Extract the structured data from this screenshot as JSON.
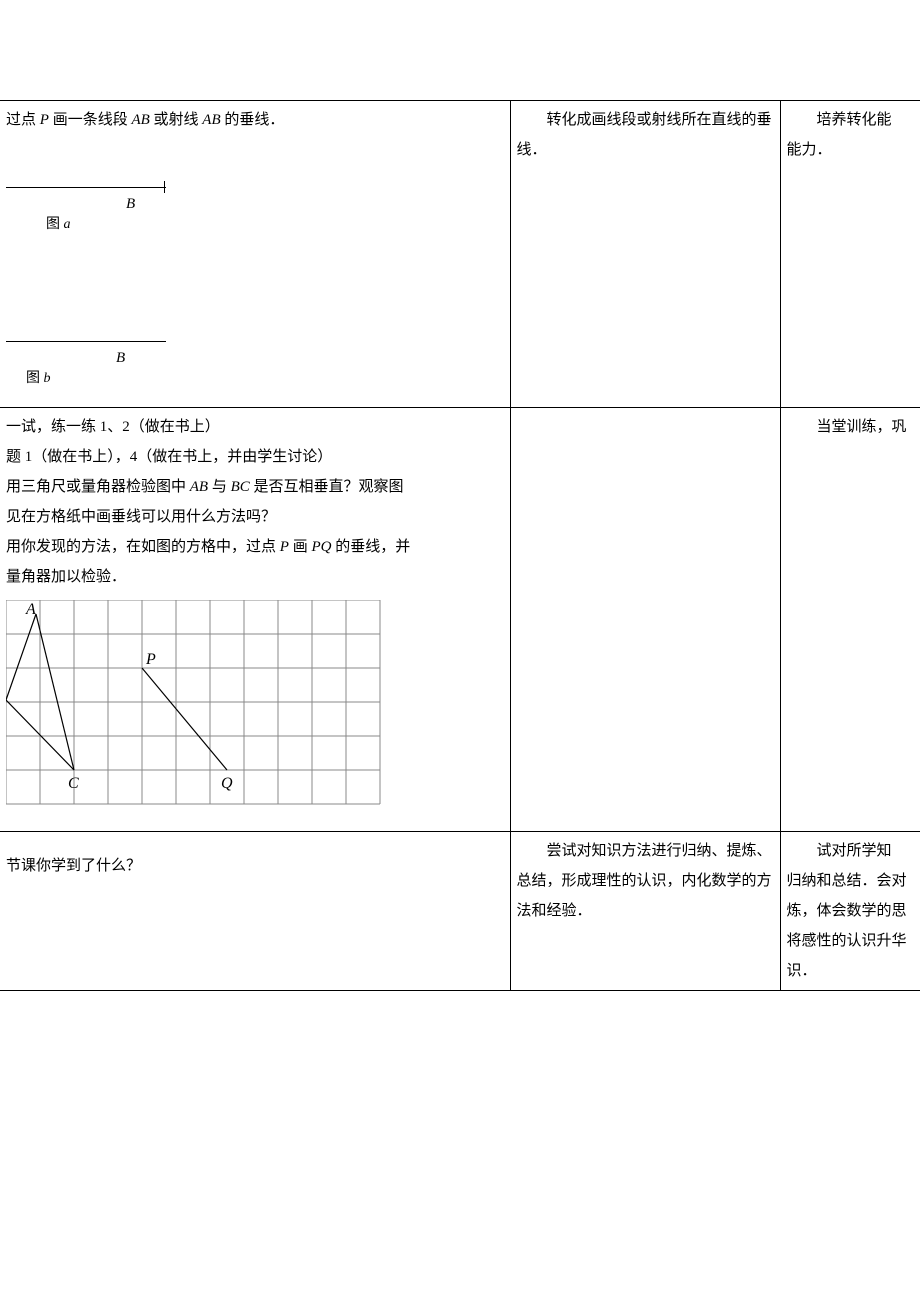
{
  "row1": {
    "col1": {
      "p1_pre": "过点 ",
      "p1_P": "P",
      "p1_mid": " 画一条线段 ",
      "p1_AB1": "AB",
      "p1_mid2": " 或射线 ",
      "p1_AB2": "AB",
      "p1_end": " 的垂线．",
      "figA_B": "B",
      "figA_caption": "图 a",
      "figB_B": "B",
      "figB_caption": "图 b"
    },
    "col2": {
      "p1": "转化成画线段或射线所在直线的垂线．"
    },
    "col3": {
      "p1": "培养转化能",
      "p2": "能力．"
    }
  },
  "row2": {
    "col1": {
      "l1": "一试，练一练 1、2（做在书上）",
      "l2": "题 1（做在书上），4（做在书上，并由学生讨论）",
      "l3_pre": "用三角尺或量角器检验图中 ",
      "l3_AB": "AB",
      "l3_mid": " 与 ",
      "l3_BC": "BC",
      "l3_end": " 是否互相垂直？观察图",
      "l4": "见在方格纸中画垂线可以用什么方法吗？",
      "l5_pre": "用你发现的方法，在如图的方格中，过点 ",
      "l5_P": "P",
      "l5_mid": " 画 ",
      "l5_PQ": "PQ",
      "l5_end": " 的垂线，并",
      "l6": "量角器加以检验．",
      "label_A": "A",
      "label_P": "P",
      "label_C": "C",
      "label_Q": "Q"
    },
    "col2": "",
    "col3": {
      "p1": "当堂训练，巩"
    }
  },
  "row3": {
    "col1": {
      "p1": "节课你学到了什么？"
    },
    "col2": {
      "p1": "尝试对知识方法进行归纳、提炼、总结，形成理性的认识，内化数学的方法和经验．"
    },
    "col3": {
      "p1": "试对所学知",
      "p2": "归纳和总结．会对",
      "p3": "炼，体会数学的思",
      "p4": "将感性的认识升华",
      "p5": "识．"
    }
  }
}
